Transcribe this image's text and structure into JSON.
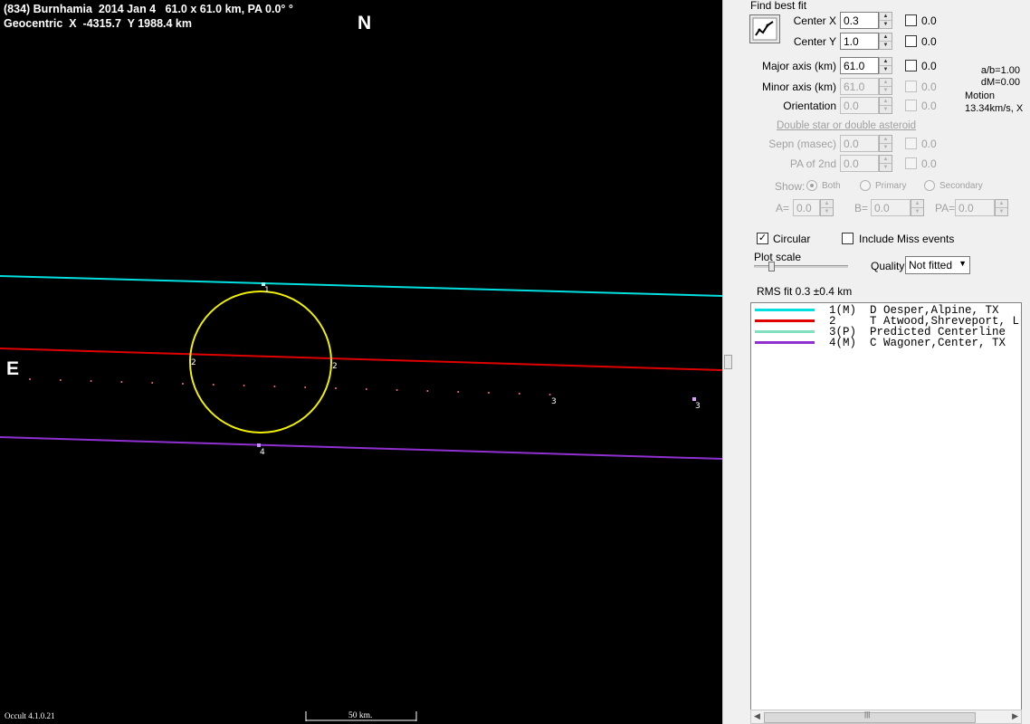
{
  "plot": {
    "header_line1": "(834) Burnhamia  2014 Jan 4   61.0 x 61.0 km, PA 0.0° °",
    "header_line2": "Geocentric  X  -4315.7  Y 1988.4 km",
    "north_label": "N",
    "east_label": "E",
    "version": "Occult 4.1.0.21",
    "scale_label": "50 km.",
    "chords": [
      {
        "id": "1",
        "color": "#00e0e0"
      },
      {
        "id": "2",
        "color": "#e00000"
      },
      {
        "id": "3",
        "color": "#ff7070"
      },
      {
        "id": "4",
        "color": "#9030d0"
      }
    ],
    "ellipse_color": "#f0f000",
    "markers": {
      "m1": "1",
      "m2a": "2",
      "m2b": "2",
      "m3a": "3",
      "m3b": "3",
      "m4": "4"
    }
  },
  "panel": {
    "title": "Find best fit",
    "center_x": {
      "label": "Center X",
      "value": "0.3",
      "check_label": "0.0"
    },
    "center_y": {
      "label": "Center Y",
      "value": "1.0",
      "check_label": "0.0"
    },
    "major_axis": {
      "label": "Major axis (km)",
      "value": "61.0",
      "check_label": "0.0"
    },
    "minor_axis": {
      "label": "Minor axis (km)",
      "value": "61.0",
      "check_label": "0.0"
    },
    "orientation": {
      "label": "Orientation",
      "value": "0.0",
      "check_label": "0.0"
    },
    "info": {
      "ab": "a/b=1.00",
      "dm": "dM=0.00",
      "motion_label": "Motion",
      "motion_value": "13.34km/s, X"
    },
    "double_star": {
      "header": "Double star  or  double asteroid",
      "sepn": {
        "label": "Sepn (masec)",
        "value": "0.0",
        "check_label": "0.0"
      },
      "pa2": {
        "label": "PA of 2nd",
        "value": "0.0",
        "check_label": "0.0"
      },
      "show_label": "Show:",
      "opt_both": "Both",
      "opt_primary": "Primary",
      "opt_secondary": "Secondary",
      "a_label": "A=",
      "a_value": "0.0",
      "b_label": "B=",
      "b_value": "0.0",
      "pa_label": "PA=",
      "pa_value": "0.0"
    },
    "circular_label": "Circular",
    "circular_checked": true,
    "include_miss_label": "Include Miss events",
    "plot_scale_label": "Plot scale",
    "quality_label": "Quality",
    "quality_value": "Not fitted",
    "rms_fit": "RMS fit 0.3 ±0.4 km"
  },
  "legend": [
    {
      "text": "1(M)  D Oesper,Alpine, TX",
      "color": "#00e0e0"
    },
    {
      "text": "2     T Atwood,Shreveport, L",
      "color": "#e00000"
    },
    {
      "text": "3(P)  Predicted Centerline",
      "color": "#80e0c0"
    },
    {
      "text": "4(M)  C Wagoner,Center, TX",
      "color": "#9030d0"
    }
  ]
}
